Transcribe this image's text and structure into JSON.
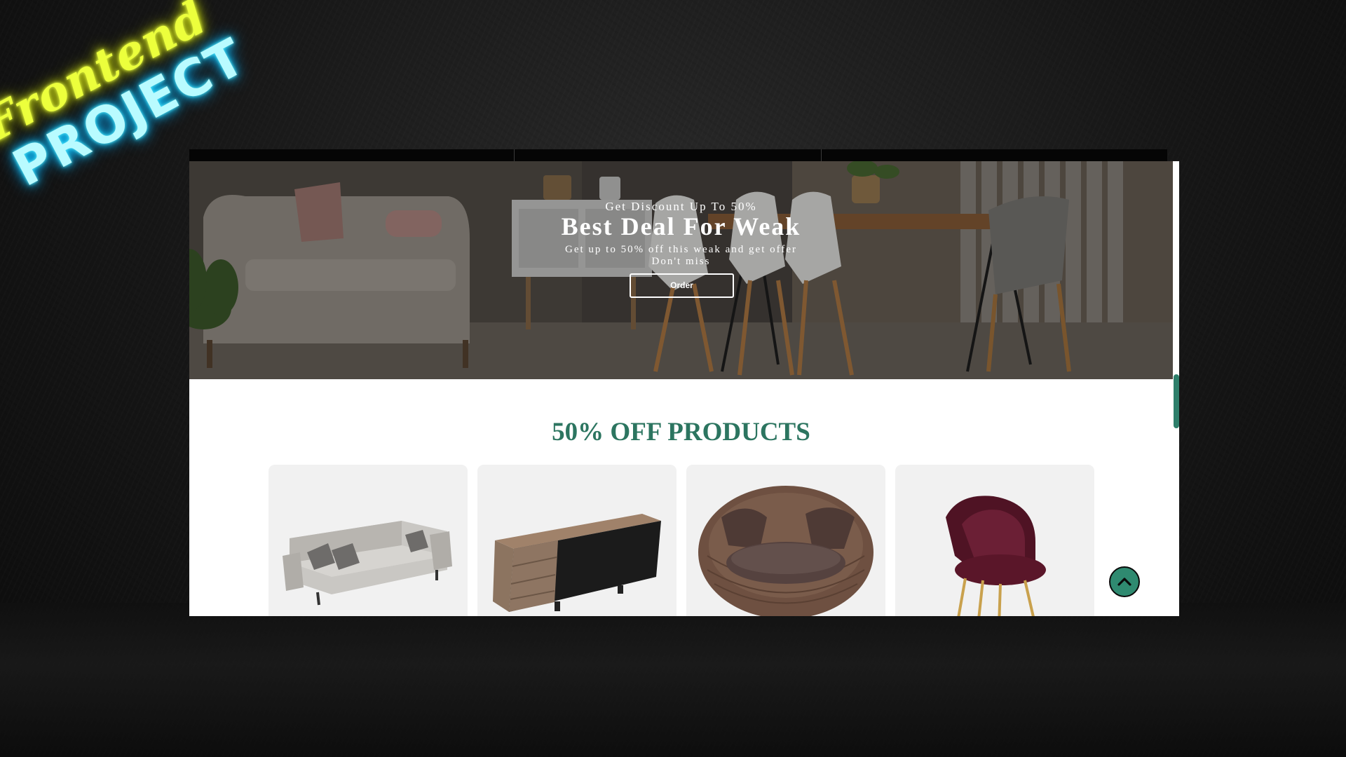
{
  "logo": {
    "script_text": "Frontend",
    "block_text": "PROJECT",
    "script_color": "#ecff3c",
    "block_color": "#b9fbff"
  },
  "hero": {
    "kicker": "Get Discount Up To 50%",
    "title": "Best Deal For Weak",
    "subtitle_line1": "Get up to 50% off this weak and get offer",
    "subtitle_line2": "Don't miss",
    "button_label": "Order"
  },
  "section": {
    "title": "50% OFF PRODUCTS",
    "accent_color": "#2c7560"
  },
  "products": [
    {
      "name": "gray-sofa",
      "icon": "sofa-image"
    },
    {
      "name": "wooden-tv-cabinet",
      "icon": "cabinet-image"
    },
    {
      "name": "rattan-round-chair",
      "icon": "rattan-chair-image"
    },
    {
      "name": "velvet-accent-chair",
      "icon": "velvet-chair-image"
    }
  ],
  "scroll_top_button": {
    "icon": "chevron-up-icon",
    "color": "#2f8a70"
  }
}
